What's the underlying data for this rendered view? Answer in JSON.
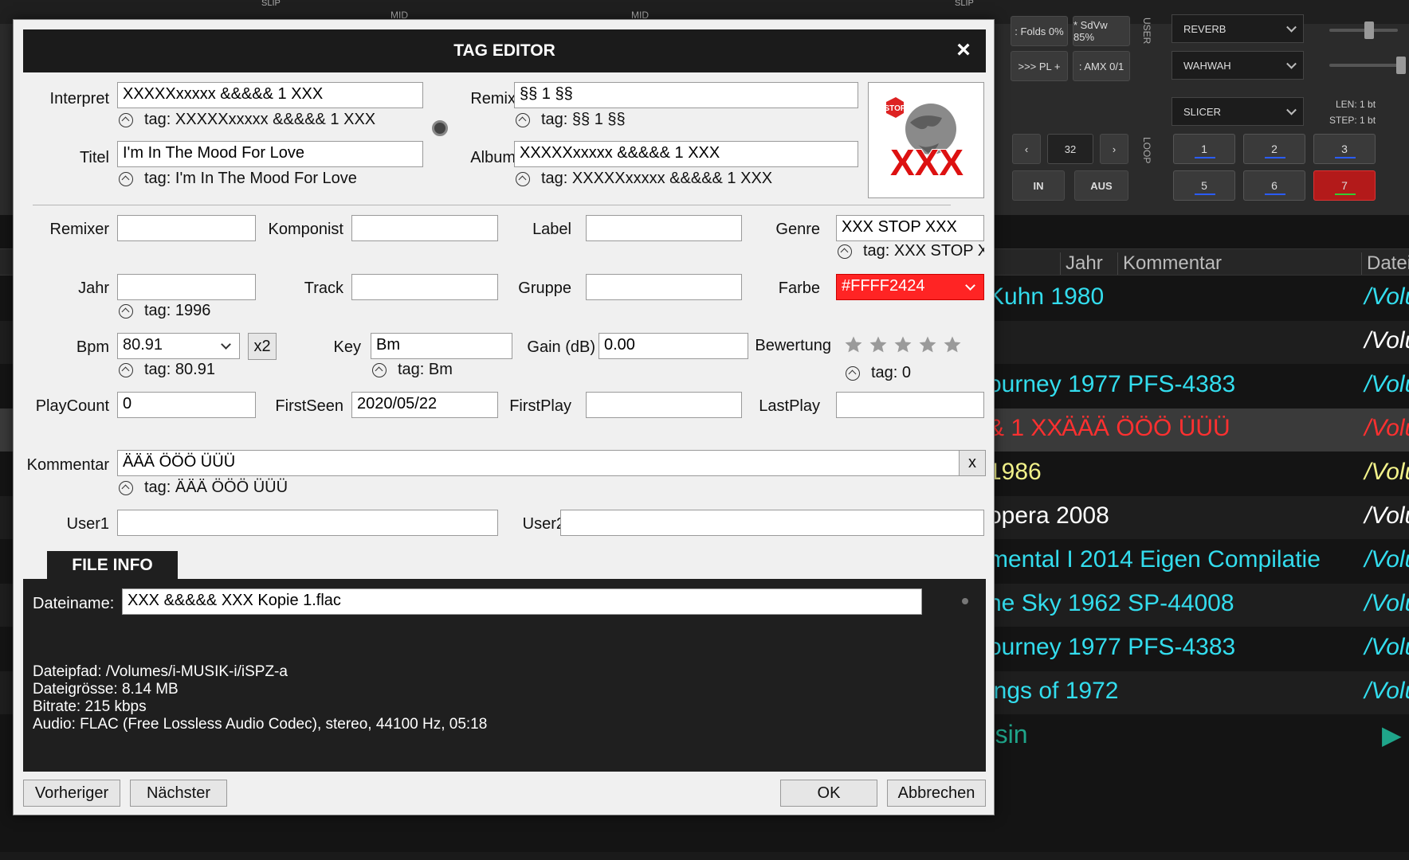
{
  "background": {
    "deck_labels": [
      "SLIP",
      "MID",
      "MID",
      "SLIP"
    ],
    "fx_buttons": [
      ": Folds 0%",
      "* SdVw 85%",
      ">>> PL +",
      ": AMX 0/1"
    ],
    "user_label": "USER",
    "loop_label": "LOOP",
    "effects": [
      "REVERB",
      "WAHWAH",
      "SLICER"
    ],
    "len_label": "LEN: 1 bt",
    "step_label": "STEP: 1 bt",
    "loop_size": "32",
    "in_label": "IN",
    "out_label": "AUS",
    "pads": [
      "1",
      "2",
      "3",
      "5",
      "6",
      "7"
    ],
    "table": {
      "headers": [
        "Jahr",
        "Kommentar",
        "Dateip"
      ],
      "rows": [
        {
          "c1": "Kuhn 1980",
          "c2": "",
          "c3": "/Volur",
          "color": "#33ddee"
        },
        {
          "c1": "",
          "c2": "",
          "c3": "/Volur",
          "color": "#ffffff"
        },
        {
          "c1": "ourney 1977 PFS-4383",
          "c2": "",
          "c3": "/Volur",
          "color": "#33ddee"
        },
        {
          "c1": "& 1 XX",
          "c2": "ÄÄÄ  ÖÖÖ  ÜÜÜ",
          "c3": "/Volum",
          "color": "#ff3030"
        },
        {
          "c1": "1986",
          "c2": "",
          "c3": "/Volur",
          "color": "#f2f28a"
        },
        {
          "c1": "opera 2008",
          "c2": "",
          "c3": "/Volur",
          "color": "#ffffff"
        },
        {
          "c1": "mental I 2014 Eigen Compilatie",
          "c2": "",
          "c3": "/Volur",
          "color": "#33ddee"
        },
        {
          "c1": "he Sky 1962 SP-44008",
          "c2": "",
          "c3": "/Volur",
          "color": "#33ddee"
        },
        {
          "c1": "ourney 1977 PFS-4383",
          "c2": "",
          "c3": "/Volur",
          "color": "#33ddee"
        },
        {
          "c1": "ings of  1972",
          "c2": "",
          "c3": "/Volur",
          "color": "#33ddee"
        }
      ],
      "footer_text": "rsin"
    }
  },
  "dialog": {
    "title": "TAG EDITOR",
    "interpret": {
      "label": "Interpret",
      "value": "XXXXXxxxxx &&&&& 1  XXX",
      "tag": "tag: XXXXXxxxxx &&&&& 1  XXX"
    },
    "remix": {
      "label": "Remix",
      "value": "§§ 1 §§",
      "tag": "tag: §§ 1 §§"
    },
    "titel": {
      "label": "Titel",
      "value": "I'm In The Mood For Love",
      "tag": "tag: I'm In The Mood For Love"
    },
    "album": {
      "label": "Album",
      "value": "XXXXXxxxxx &&&&& 1  XXX",
      "tag": "tag: XXXXXxxxxx &&&&& 1  XXX"
    },
    "cover_text": "XXX",
    "remixer": {
      "label": "Remixer",
      "value": ""
    },
    "komponist": {
      "label": "Komponist",
      "value": ""
    },
    "label_field": {
      "label": "Label",
      "value": ""
    },
    "genre": {
      "label": "Genre",
      "value": "XXX STOP XXX",
      "tag": "tag: XXX STOP X"
    },
    "jahr": {
      "label": "Jahr",
      "value": "",
      "tag": "tag: 1996"
    },
    "track": {
      "label": "Track",
      "value": ""
    },
    "gruppe": {
      "label": "Gruppe",
      "value": ""
    },
    "farbe": {
      "label": "Farbe",
      "value": "#FFFF2424",
      "color": "#ff2424"
    },
    "bpm": {
      "label": "Bpm",
      "value": "80.91",
      "tag": "tag: 80.91",
      "x2": "x2"
    },
    "key": {
      "label": "Key",
      "value": "Bm",
      "tag": "tag: Bm"
    },
    "gain": {
      "label": "Gain (dB)",
      "value": "0.00"
    },
    "bewertung": {
      "label": "Bewertung",
      "rating": 0,
      "max": 5,
      "tag": "tag: 0"
    },
    "playcount": {
      "label": "PlayCount",
      "value": "0"
    },
    "firstseen": {
      "label": "FirstSeen",
      "value": "2020/05/22"
    },
    "firstplay": {
      "label": "FirstPlay",
      "value": ""
    },
    "lastplay": {
      "label": "LastPlay",
      "value": ""
    },
    "kommentar": {
      "label": "Kommentar",
      "value": "ÄÄÄ  ÖÖÖ   ÜÜÜ",
      "tag": "tag: ÄÄÄ  ÖÖÖ   ÜÜÜ",
      "clear": "x"
    },
    "user1": {
      "label": "User1",
      "value": ""
    },
    "user2": {
      "label": "User2",
      "value": ""
    },
    "file_info": {
      "tab": "FILE INFO",
      "dateiname_label": "Dateiname:",
      "dateiname": "XXX &&&&& XXX Kopie 1.flac",
      "dateipfad": "Dateipfad: /Volumes/i-MUSIK-i/iSPZ-a",
      "dateigroesse": "Dateigrösse: 8.14 MB",
      "bitrate": "Bitrate: 215 kbps",
      "audio": "Audio: FLAC (Free Lossless Audio Codec), stereo, 44100 Hz, 05:18"
    },
    "buttons": {
      "prev": "Vorheriger",
      "next": "Nächster",
      "ok": "OK",
      "cancel": "Abbrechen"
    }
  }
}
